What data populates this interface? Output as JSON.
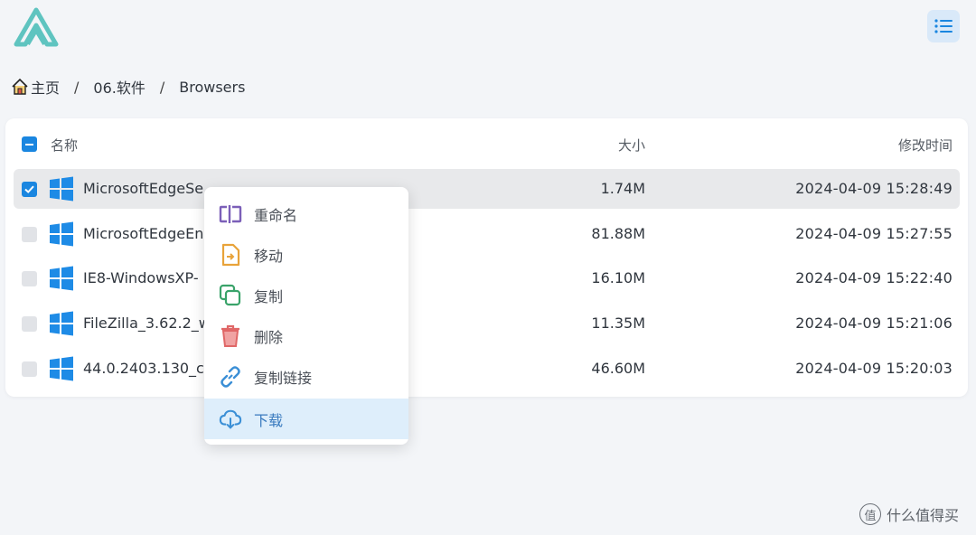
{
  "header": {
    "logo_icon": "app-logo-icon",
    "view_toggle_icon": "list-view-icon"
  },
  "breadcrumb": {
    "home": "主页",
    "folder": "06.软件",
    "current": "Browsers",
    "separator": "/"
  },
  "table": {
    "columns": {
      "name": "名称",
      "size": "大小",
      "modified": "修改时间"
    },
    "rows": [
      {
        "name": "MicrosoftEdgeSe",
        "size": "1.74M",
        "modified": "2024-04-09 15:28:49",
        "checked": true
      },
      {
        "name": "MicrosoftEdgeEn",
        "size": "81.88M",
        "modified": "2024-04-09 15:27:55",
        "checked": false
      },
      {
        "name": "IE8-WindowsXP-",
        "size": "16.10M",
        "modified": "2024-04-09 15:22:40",
        "checked": false
      },
      {
        "name": "FileZilla_3.62.2_w",
        "size": "11.35M",
        "modified": "2024-04-09 15:21:06",
        "checked": false
      },
      {
        "name": "44.0.2403.130_ch",
        "size": "46.60M",
        "modified": "2024-04-09 15:20:03",
        "checked": false
      }
    ]
  },
  "context_menu": {
    "items": [
      {
        "label": "重命名",
        "icon": "rename-icon",
        "color": "#7b5fb8"
      },
      {
        "label": "移动",
        "icon": "move-icon",
        "color": "#e8a33a"
      },
      {
        "label": "复制",
        "icon": "copy-icon",
        "color": "#3aa36a"
      },
      {
        "label": "删除",
        "icon": "delete-icon",
        "color": "#e06767"
      },
      {
        "label": "复制链接",
        "icon": "link-icon",
        "color": "#3b8fd6"
      },
      {
        "label": "下载",
        "icon": "download-icon",
        "color": "#3b8fd6",
        "active": true
      }
    ]
  },
  "watermark": {
    "text": "什么值得买",
    "mark": "值"
  },
  "colors": {
    "accent": "#1a86e0",
    "background": "#f3f5f8",
    "logo": "#5fc4c0"
  }
}
